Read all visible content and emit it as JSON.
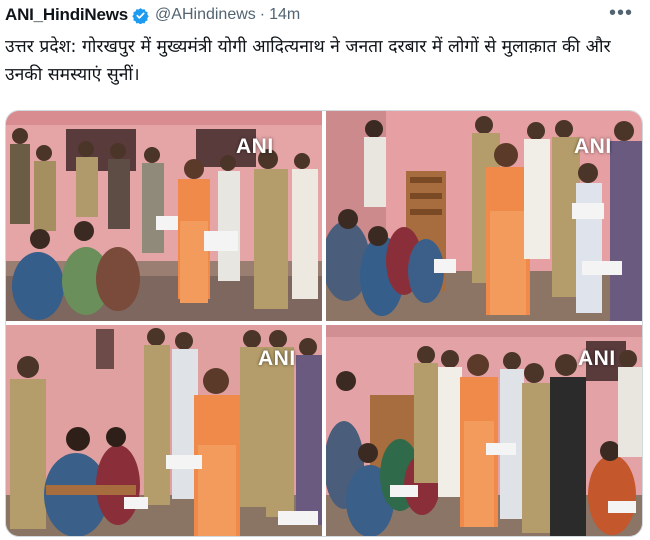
{
  "tweet": {
    "display_name": "ANI_HindiNews",
    "handle": "@AHindinews",
    "separator": "·",
    "time": "14m",
    "more_label": "•••",
    "text": "उत्तर प्रदेश: गोरखपुर में मुख्यमंत्री योगी आदित्यनाथ ने जनता दरबार में लोगों से मुलाक़ात की और उनकी समस्याएं सुनीं।"
  },
  "media": {
    "photos": [
      {
        "watermark": "ANI"
      },
      {
        "watermark": "ANI"
      },
      {
        "watermark": "ANI"
      },
      {
        "watermark": "ANI"
      }
    ]
  },
  "colors": {
    "verified_badge": "#1d9bf0",
    "saffron": "#f08a4b",
    "wall_pink": "#e59aa0",
    "khaki": "#b49d6a"
  },
  "icons": {
    "verified": "verified-badge-icon",
    "more": "more-options-icon"
  }
}
